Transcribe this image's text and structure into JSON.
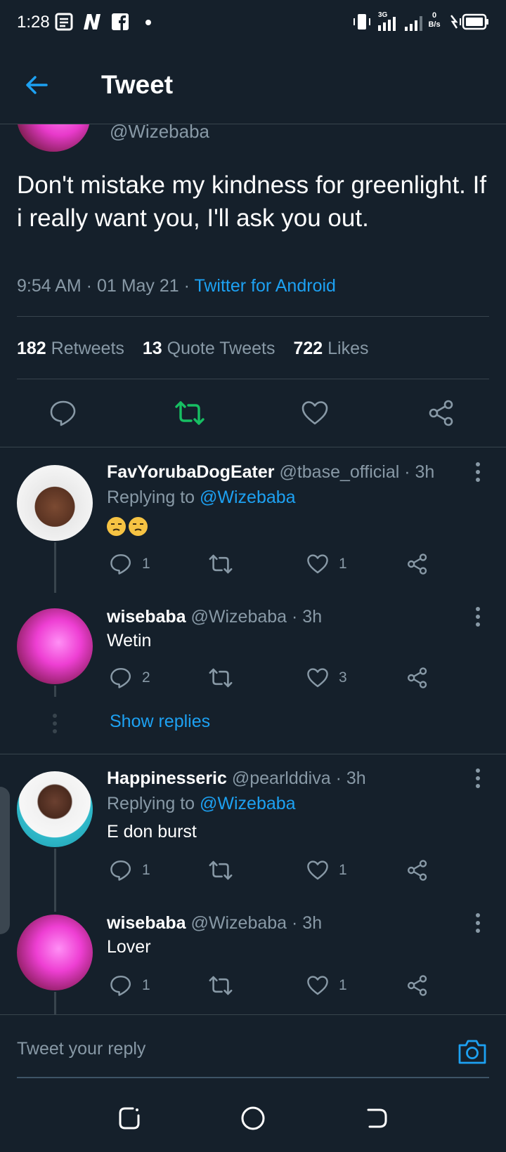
{
  "status_bar": {
    "time": "1:28",
    "icons": [
      "notes-icon",
      "n-app-icon",
      "facebook-icon",
      "dot-icon",
      "vibrate-icon",
      "signal-3g-icon",
      "signal-icon",
      "data-speed-icon",
      "battery-charging-icon"
    ],
    "network_label": "3G",
    "speed_value": "0",
    "speed_unit": "B/s"
  },
  "header": {
    "title": "Tweet"
  },
  "main_tweet": {
    "handle": "@Wizebaba",
    "text": "Don't mistake my kindness for greenlight. If i really want you, I'll ask you out.",
    "time": "9:54 AM · 01 May 21 · ",
    "source": "Twitter for Android",
    "retweets_count": "182",
    "retweets_label": "Retweets",
    "quotes_count": "13",
    "quotes_label": "Quote Tweets",
    "likes_count": "722",
    "likes_label": "Likes"
  },
  "replies": [
    {
      "name": "FavYorubaDogEater",
      "handle": "@tbase_official",
      "time": "· 3h",
      "replying_prefix": "Replying to ",
      "replying_to": "@Wizebaba",
      "text": "",
      "emoji_count": 2,
      "reply_count": "1",
      "like_count": "1"
    },
    {
      "name": "wisebaba",
      "handle": "@Wizebaba",
      "time": "· 3h",
      "text": "Wetin",
      "reply_count": "2",
      "like_count": "3"
    },
    {
      "name": "Happinesseric",
      "handle": "@pearlddiva",
      "time": "· 3h",
      "replying_prefix": "Replying to ",
      "replying_to": "@Wizebaba",
      "text": "E don burst",
      "reply_count": "1",
      "like_count": "1"
    },
    {
      "name": "wisebaba",
      "handle": "@Wizebaba",
      "time": "· 3h",
      "text": "Lover",
      "reply_count": "1",
      "like_count": "1"
    }
  ],
  "show_replies_label": "Show replies",
  "composer": {
    "placeholder": "Tweet your reply"
  },
  "colors": {
    "background": "#15202b",
    "accent": "#1da1f2",
    "retweet_active": "#17bf63",
    "muted": "#8899a6",
    "divider": "#38444d"
  }
}
